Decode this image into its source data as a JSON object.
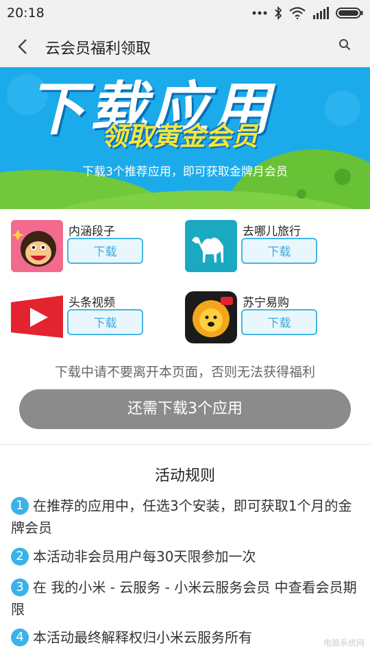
{
  "status": {
    "time": "20:18"
  },
  "titlebar": {
    "title": "云会员福利领取"
  },
  "banner": {
    "headline": "下载应用",
    "subline": "领取黄金会员",
    "note": "下载3个推荐应用，即可获取金牌月会员"
  },
  "apps": [
    {
      "name": "内涵段子",
      "button": "下载",
      "icon": "monkey-face-icon"
    },
    {
      "name": "去哪儿旅行",
      "button": "下载",
      "icon": "camel-icon"
    },
    {
      "name": "头条视频",
      "button": "下载",
      "icon": "play-icon"
    },
    {
      "name": "苏宁易购",
      "button": "下载",
      "icon": "lion-icon"
    }
  ],
  "warning": "下载中请不要离开本页面，否则无法获得福利",
  "main_button": "还需下载3个应用",
  "rules": {
    "title": "活动规则",
    "items": [
      {
        "num": "1",
        "text": "在推荐的应用中，任选3个安装，即可获取1个月的金牌会员"
      },
      {
        "num": "2",
        "text": "本活动非会员用户每30天限参加一次"
      },
      {
        "num": "3",
        "text": "在 我的小米 - 云服务 - 小米云服务会员 中查看会员期限"
      },
      {
        "num": "4",
        "text": "本活动最终解释权归小米云服务所有"
      }
    ]
  },
  "watermark": "电脑系统网",
  "colors": {
    "accent": "#39b3e8",
    "disabled_button": "#8b8b8b",
    "banner_bg": "#19a6e6"
  }
}
